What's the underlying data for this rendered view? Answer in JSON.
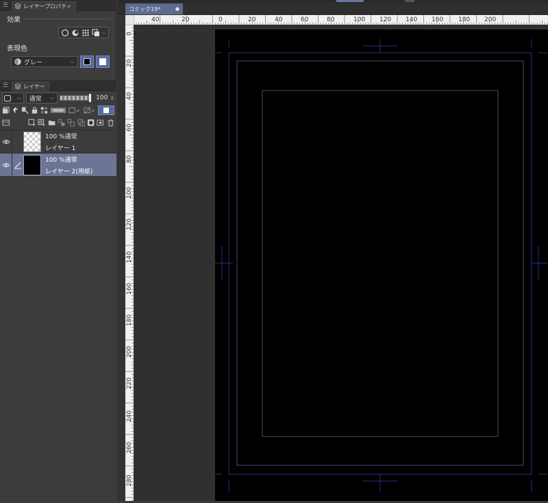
{
  "layer_property_panel": {
    "tab_label": "レイヤープロパティ",
    "effect_label": "効果",
    "expression_color_label": "表現色",
    "expression_color_value": "グレー",
    "effect_icons": [
      "border-effect-icon",
      "extract-line-icon",
      "tone-icon",
      "layer-color-icon"
    ],
    "accent_color": "#566aa0"
  },
  "layer_panel": {
    "tab_label": "レイヤー",
    "blend_mode": "通常",
    "opacity_value": "100",
    "layers": [
      {
        "opacity_mode": "100 %通常",
        "name": "レイヤー 1",
        "selected": false,
        "thumbnail": "transparent"
      },
      {
        "opacity_mode": "100 %通常",
        "name": "レイヤー 2(用紙)",
        "selected": true,
        "thumbnail": "black"
      }
    ],
    "selected_color": "#6c7594"
  },
  "document": {
    "tab_label": "コミック19*",
    "close_glyph": "●"
  },
  "rulers": {
    "horizontal_labels": [
      "40",
      "20",
      "0",
      "20",
      "40",
      "60",
      "80",
      "100",
      "120",
      "140",
      "160",
      "180",
      "200"
    ],
    "vertical_labels": [
      "0",
      "20",
      "40",
      "60",
      "80",
      "100",
      "120",
      "140",
      "160",
      "180",
      "200",
      "220",
      "240",
      "260",
      "280"
    ]
  },
  "canvas": {
    "paper_color": "#000000",
    "guide_color": "#2a2f8a",
    "frame_color": "#4a4d6a"
  }
}
